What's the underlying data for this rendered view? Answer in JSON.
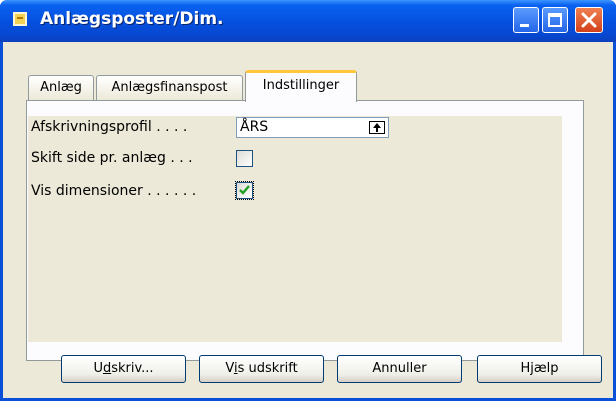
{
  "window": {
    "title": "Anlægsposter/Dim.",
    "controls": {
      "minimize": "minimize-icon",
      "maximize": "maximize-icon",
      "close": "close-icon"
    }
  },
  "tabs": [
    {
      "label": "Anlæg",
      "active": false
    },
    {
      "label": "Anlægsfinanspost",
      "active": false
    },
    {
      "label": "Indstillinger",
      "active": true
    }
  ],
  "options": {
    "profile_label": "Afskrivningsprofil . . . .",
    "profile_value": "ÅRS",
    "page_label": "Skift side pr. anlæg . . .",
    "page_checked": false,
    "dim_label": "Vis dimensioner . . . . . .",
    "dim_checked": true
  },
  "buttons": {
    "print_prefix": "U",
    "print_u": "d",
    "print_rest": "skriv...",
    "preview_prefix": "V",
    "preview_u": "i",
    "preview_rest": "s udskrift",
    "cancel": "Annuller",
    "help": "Hjælp"
  },
  "colors": {
    "titlebar": "#0651e0",
    "face": "#ece9d8",
    "active_tab_accent": "#ffc83c",
    "check": "#21a121"
  }
}
